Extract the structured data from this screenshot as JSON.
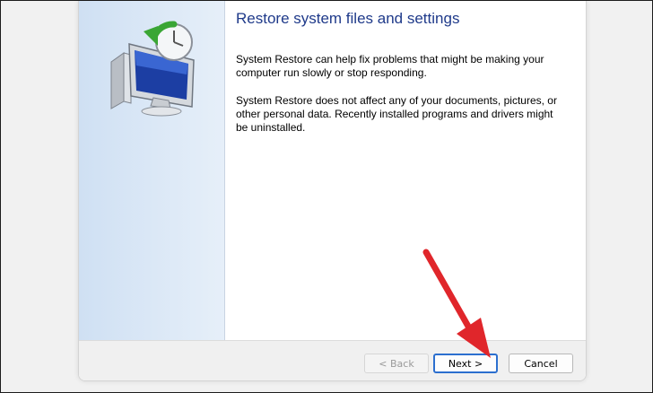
{
  "dialog": {
    "title": "Restore system files and settings",
    "paragraph1": "System Restore can help fix problems that might be making your computer run slowly or stop responding.",
    "paragraph2": "System Restore does not affect any of your documents, pictures, or other personal data. Recently installed programs and drivers might be uninstalled."
  },
  "buttons": {
    "back_label": "< Back",
    "next_label": "Next >",
    "cancel_label": "Cancel"
  },
  "colors": {
    "title": "#1f3a8a",
    "accent": "#2c6fcf",
    "annotation_arrow": "#e0262b"
  },
  "icons": {
    "illustration": "system-restore-icon",
    "annotation": "red-arrow"
  }
}
